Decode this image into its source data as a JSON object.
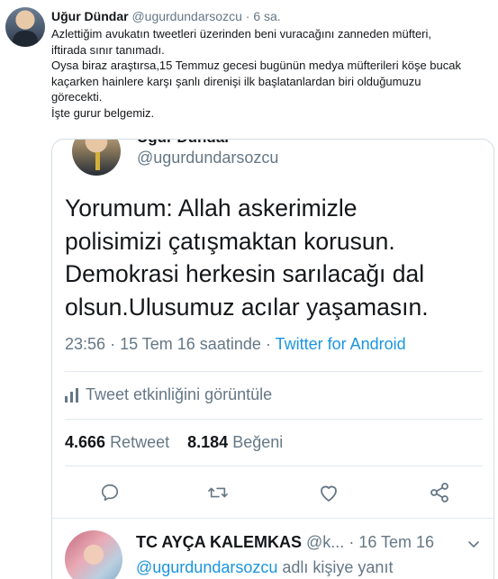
{
  "tweet": {
    "author_name": "Uğur Dündar",
    "author_handle": "@ugurdundarsozcu",
    "separator": "·",
    "time": "6 sa.",
    "text_lines": [
      "Azlettiğim avukatın tweetleri üzerinden beni vuracağını zanneden müfteri,",
      "iftirada sınır tanımadı.",
      "Oysa biraz araştırsa,15 Temmuz gecesi bugünün medya müfterileri  köşe bucak",
      "kaçarken hainlere karşı şanlı direnişi ilk başlatanlardan biri olduğumuzu",
      "görecekti.",
      "İşte gurur belgemiz."
    ]
  },
  "quoted": {
    "author_name_partial": "Uğur Dündar",
    "author_handle": "@ugurdundarsozcu",
    "text_lines": [
      "Yorumum: Allah askerimizle",
      "polisimizi çatışmaktan korusun.",
      "Demokrasi herkesin sarılacağı dal",
      "olsun.Ulusumuz acılar yaşamasın."
    ],
    "time": "23:56",
    "date": "15 Tem 16 saatinde",
    "source": "Twitter for Android",
    "separator": "·",
    "activity_label": "Tweet etkinliğini görüntüle",
    "retweet_count": "4.666",
    "retweet_label": "Retweet",
    "like_count": "8.184",
    "like_label": "Beğeni",
    "icons": {
      "reply": "reply-icon",
      "retweet": "retweet-icon",
      "like": "heart-icon",
      "share": "share-icon",
      "activity": "bar-chart-icon"
    }
  },
  "reply": {
    "author_name": "TC AYÇA KALEMKAS",
    "author_handle": "@k...",
    "separator": "·",
    "date": "16 Tem 16",
    "mention": "@ugurdundarsozcu",
    "reply_to_label": "adlı kişiye yanıt"
  },
  "colors": {
    "text": "#14171a",
    "secondary": "#657786",
    "link": "#1b95e0",
    "border": "#e1e8ed"
  }
}
